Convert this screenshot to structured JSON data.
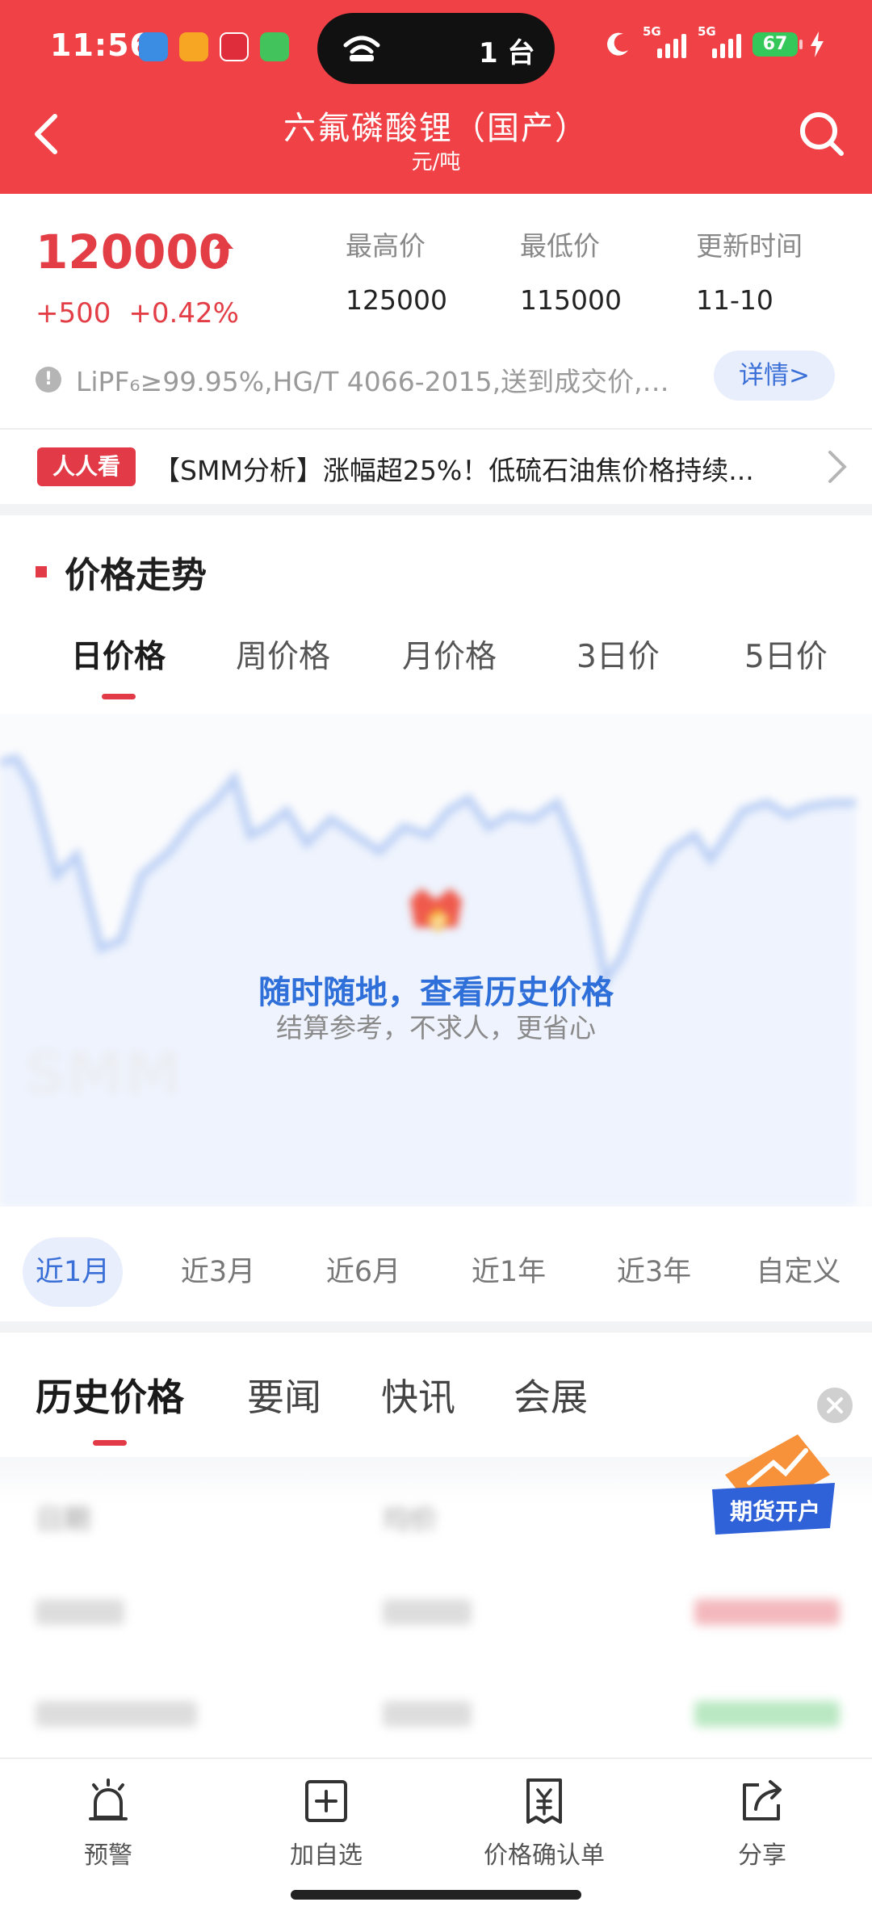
{
  "status_bar": {
    "time": "11:56",
    "island_count": "1 台",
    "battery": "67",
    "signal_labels": [
      "5G",
      "5G"
    ]
  },
  "header": {
    "title": "六氟磷酸锂（国产）",
    "subtitle": "元/吨"
  },
  "price": {
    "current": "120000",
    "change_abs": "+500",
    "change_pct": "+0.42%",
    "stats": [
      {
        "label": "最高价",
        "value": "125000"
      },
      {
        "label": "最低价",
        "value": "115000"
      },
      {
        "label": "更新时间",
        "value": "11-10"
      }
    ],
    "spec_text": "LiPF₆≥99.95%,HG/T 4066-2015,送到成交价,含...",
    "details_label": "详情>"
  },
  "ticker": {
    "badge": "人人看",
    "headline": "【SMM分析】涨幅超25%！低硫石油焦价格持续..."
  },
  "trend": {
    "title": "价格走势",
    "period_tabs": [
      "日价格",
      "周价格",
      "月价格",
      "3日价",
      "5日价"
    ],
    "active_period": 0,
    "overlay_title": "随时随地，查看历史价格",
    "overlay_sub": "结算参考，不求人，更省心",
    "range_tabs": [
      "近1月",
      "近3月",
      "近6月",
      "近1年",
      "近3年",
      "自定义"
    ],
    "active_range": 0,
    "colors": {
      "line": "#bcd0f5",
      "fill": "#eef3fd",
      "accent": "#e23a46",
      "brand": "#ef4146"
    }
  },
  "history": {
    "tabs": [
      "历史价格",
      "要闻",
      "快讯",
      "会展"
    ],
    "active_tab": 0,
    "rows": [
      {
        "date": "日期",
        "price": "均价",
        "change": ""
      },
      {
        "date": "",
        "price": "",
        "change": ""
      },
      {
        "date": "",
        "price": "",
        "change": ""
      }
    ]
  },
  "promo": {
    "label": "期货开户"
  },
  "bottom_bar": {
    "items": [
      {
        "label": "预警",
        "icon": "alarm-icon"
      },
      {
        "label": "加自选",
        "icon": "add-watchlist-icon"
      },
      {
        "label": "价格确认单",
        "icon": "price-confirmation-icon"
      },
      {
        "label": "分享",
        "icon": "share-icon"
      }
    ]
  }
}
